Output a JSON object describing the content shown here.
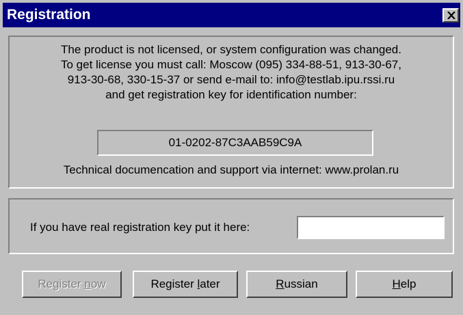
{
  "window": {
    "title": "Registration"
  },
  "info": {
    "lines": [
      "The product is not licensed, or system configuration was changed.",
      "To get license you must call: Moscow (095) 334-88-51, 913-30-67,",
      "913-30-68, 330-15-37 or send e-mail to: info@testlab.ipu.rssi.ru",
      "and get registration key for identification number:"
    ],
    "identification_number": "01-0202-87C3AAB59C9A",
    "support": "Technical documencation and support via internet: www.prolan.ru"
  },
  "key": {
    "label": "If you have real registration key put it here:",
    "value": ""
  },
  "buttons": {
    "register_now": {
      "pre": "Register ",
      "accel": "n",
      "post": "ow",
      "enabled": false
    },
    "register_later": {
      "pre": "Register ",
      "accel": "l",
      "post": "ater",
      "enabled": true
    },
    "russian": {
      "pre": "",
      "accel": "R",
      "post": "ussian",
      "enabled": true
    },
    "help": {
      "pre": "",
      "accel": "H",
      "post": "elp",
      "enabled": true
    }
  },
  "icons": {
    "close": "close-icon"
  },
  "colors": {
    "titlebar": "#000080",
    "face": "#c0c0c0"
  }
}
